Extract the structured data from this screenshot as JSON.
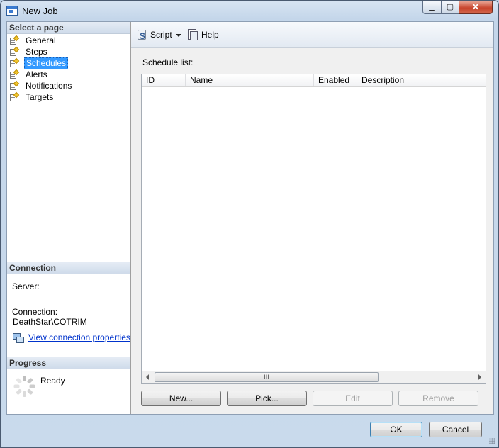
{
  "window": {
    "title": "New Job",
    "minimize_glyph": "▁",
    "maximize_glyph": "▢",
    "close_glyph": "✕"
  },
  "sidebar": {
    "select_page_header": "Select a page",
    "items": [
      {
        "label": "General",
        "selected": false
      },
      {
        "label": "Steps",
        "selected": false
      },
      {
        "label": "Schedules",
        "selected": true
      },
      {
        "label": "Alerts",
        "selected": false
      },
      {
        "label": "Notifications",
        "selected": false
      },
      {
        "label": "Targets",
        "selected": false
      }
    ],
    "connection_header": "Connection",
    "server_label": "Server:",
    "connection_label": "Connection:",
    "connection_value": "DeathStar\\COTRIM",
    "view_properties_link": "View connection properties",
    "progress_header": "Progress",
    "progress_status": "Ready"
  },
  "toolbar": {
    "script_label": "Script",
    "help_label": "Help"
  },
  "schedules": {
    "list_label": "Schedule list:",
    "columns": [
      "ID",
      "Name",
      "Enabled",
      "Description"
    ],
    "rows": [],
    "scroll_thumb_glyph": "III"
  },
  "actions": {
    "new_label": "New...",
    "pick_label": "Pick...",
    "edit_label": "Edit",
    "remove_label": "Remove"
  },
  "footer": {
    "ok_label": "OK",
    "cancel_label": "Cancel"
  }
}
